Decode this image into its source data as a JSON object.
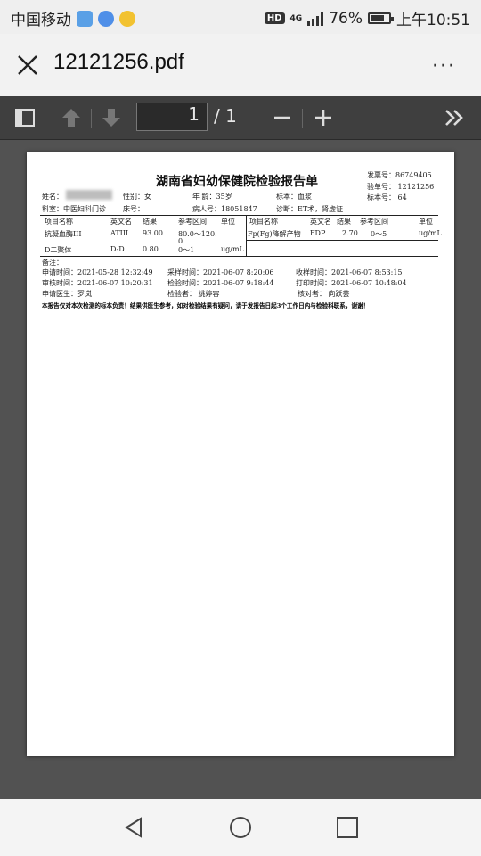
{
  "status": {
    "carrier": "中国移动",
    "hd": "HD",
    "net": "4G",
    "battery": "76%",
    "battery_level": 0.76,
    "time": "上午10:51"
  },
  "header": {
    "filename": "12121256.pdf",
    "more": "···"
  },
  "toolbar": {
    "current_page": "1",
    "page_total": "/ 1"
  },
  "report": {
    "title": "湖南省妇幼保健院检验报告单",
    "invoice": "发票号：86749405",
    "test_no": "验单号：  12121256",
    "sample_no": "标本号：  64",
    "name_label": "姓名：",
    "gender": "性别：女",
    "age": "年   龄：35岁",
    "specimen": "标本：血浆",
    "dept": "科室：中医妇科门诊",
    "bed": "床号：",
    "patient_no": "病人号：18051847",
    "diagnosis": "诊断：ET术，肾虚证",
    "col_headers": {
      "item": "项目名称",
      "en": "英文名",
      "result": "结果",
      "ref": "参考区间",
      "unit": "单位",
      "item2": "项目名称",
      "en2": "英文名",
      "result2": "结果",
      "ref2": "参考区间",
      "unit2": "单位"
    },
    "rows": [
      {
        "item": "抗凝血酶III",
        "en": "ATIII",
        "result": "93.00",
        "ref": "80.0～120.",
        "ref2": "0",
        "unit": ""
      },
      {
        "item": "D二聚体",
        "en": "D-D",
        "result": "0.80",
        "ref": "0～1",
        "unit": "ug/mL"
      }
    ],
    "right_rows": [
      {
        "item": "Fp(Fg)降解产物",
        "en": "FDP",
        "result": "2.70",
        "ref": "0～5",
        "unit": "ug/mL"
      }
    ],
    "remark": "备注：",
    "apply_time": "申请时间：2021-05-28   12:32:49",
    "collect_time": "采样时间：2021-06-07  8:20:06",
    "receive_time": "收样时间：2021-06-07  8:53:15",
    "review_time": "审核时间：2021-06-07   10:20:31",
    "test_time": "检验时间：2021-06-07    9:18:44",
    "print_time": "打印时间：2021-06-07  10:48:04",
    "doctor": "申请医生：罗岚",
    "tester": "检验者：  姚婷容",
    "checker": "核对者：   向跃芸",
    "disclaimer": "本报告仅对本次检测的标本负责！结果供医生参考，如对检验结果有疑问，请于发报告日起3个工作日内与检验科联系，谢谢！"
  },
  "colors": {
    "toolbar": "#3f3f3f",
    "viewer_bg": "#525252",
    "page": "#ffffff"
  }
}
